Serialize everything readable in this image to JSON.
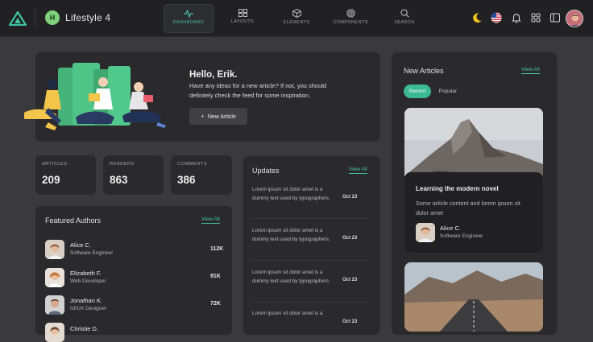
{
  "workspace": {
    "initial": "H",
    "name": "Lifestyle 4"
  },
  "nav": [
    {
      "label": "DASHBOARD",
      "icon": "activity-icon"
    },
    {
      "label": "LAYOUTS",
      "icon": "grid-icon"
    },
    {
      "label": "ELEMENTS",
      "icon": "cube-icon"
    },
    {
      "label": "COMPONENTS",
      "icon": "cpu-icon"
    },
    {
      "label": "SEARCH",
      "icon": "search-icon"
    }
  ],
  "hero": {
    "title": "Hello, Erik.",
    "text": "Have any ideas for a new article? If not, you should definitely check the feed for some inspiration.",
    "button": "New Article"
  },
  "stats": [
    {
      "label": "ARTICLES",
      "value": "209"
    },
    {
      "label": "READERS",
      "value": "863"
    },
    {
      "label": "COMMENTS",
      "value": "386"
    }
  ],
  "updates": {
    "title": "Updates",
    "view_all": "View All",
    "items": [
      {
        "text": "Lorem ipsum sit dolor amet is a dummy text used by typographers.",
        "date": "Oct 23"
      },
      {
        "text": "Lorem ipsum sit dolor amet is a dummy text used by typographers.",
        "date": "Oct 23"
      },
      {
        "text": "Lorem ipsum sit dolor amet is a dummy text used by typographers.",
        "date": "Oct 23"
      },
      {
        "text": "Lorem ipsum sit dolor amet is a",
        "date": "Oct 23"
      }
    ]
  },
  "authors": {
    "title": "Featured Authors",
    "view_all": "View All",
    "items": [
      {
        "name": "Alice C.",
        "role": "Software Engineer",
        "count": "112K"
      },
      {
        "name": "Elizabeth F.",
        "role": "Web Developer",
        "count": "91K"
      },
      {
        "name": "Jonathan K.",
        "role": "UI/UX Designer",
        "count": "72K"
      },
      {
        "name": "Christie D.",
        "role": "",
        "count": ""
      }
    ]
  },
  "new_articles": {
    "title": "New Articles",
    "view_all": "View All",
    "tabs": [
      "Recent",
      "Popular"
    ],
    "featured": {
      "title": "Learning the modern novel",
      "text": "Some article content and lorem ipsum sit dolor amet",
      "author_name": "Alice C.",
      "author_role": "Software Engineer"
    }
  },
  "colors": {
    "accent": "#47c6a2",
    "workspace_badge": "#7ed27a"
  }
}
